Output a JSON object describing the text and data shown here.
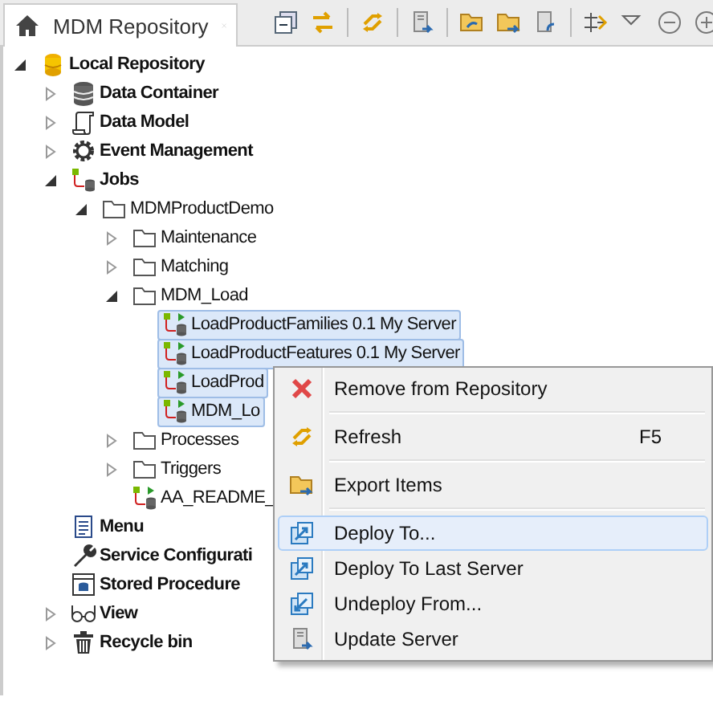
{
  "tab": {
    "title": "MDM Repository",
    "selected": true
  },
  "tree": [
    {
      "label": "Local Repository",
      "kind": "database",
      "expanded": true,
      "selected": false,
      "children": [
        {
          "label": "Data Container",
          "kind": "container",
          "expanded": false,
          "selected": false
        },
        {
          "label": "Data Model",
          "kind": "model",
          "expanded": false,
          "selected": false
        },
        {
          "label": "Event Management",
          "kind": "event",
          "expanded": false,
          "selected": false
        },
        {
          "label": "Jobs",
          "kind": "jobs",
          "expanded": true,
          "selected": false,
          "children": [
            {
              "label": "MDMProductDemo",
              "kind": "folder",
              "expanded": true,
              "selected": false,
              "children": [
                {
                  "label": "Maintenance",
                  "kind": "folder",
                  "expanded": false,
                  "selected": false
                },
                {
                  "label": "Matching",
                  "kind": "folder",
                  "expanded": false,
                  "selected": false
                },
                {
                  "label": "MDM_Load",
                  "kind": "folder",
                  "expanded": true,
                  "selected": false,
                  "children": [
                    {
                      "label": "LoadProductFamilies 0.1 My Server",
                      "kind": "job",
                      "selected": true
                    },
                    {
                      "label": "LoadProductFeatures 0.1 My Server",
                      "kind": "job",
                      "selected": true
                    },
                    {
                      "label": "LoadProd",
                      "kind": "job",
                      "selected": true
                    },
                    {
                      "label": "MDM_Lo",
                      "kind": "job",
                      "selected": true
                    }
                  ]
                },
                {
                  "label": "Processes",
                  "kind": "folder",
                  "expanded": false,
                  "selected": false
                },
                {
                  "label": "Triggers",
                  "kind": "folder",
                  "expanded": false,
                  "selected": false
                },
                {
                  "label": "AA_README_",
                  "kind": "job",
                  "selected": false
                }
              ]
            }
          ]
        },
        {
          "label": "Menu",
          "kind": "menu",
          "selected": false
        },
        {
          "label": "Service Configurati",
          "kind": "service",
          "selected": false
        },
        {
          "label": "Stored Procedure",
          "kind": "procedure",
          "selected": false
        },
        {
          "label": "View",
          "kind": "view",
          "expanded": false,
          "selected": false
        },
        {
          "label": "Recycle bin",
          "kind": "recycle",
          "expanded": false,
          "selected": false
        }
      ]
    }
  ],
  "context_menu": [
    {
      "label": "Remove from Repository",
      "kind": "remove",
      "selected": false,
      "separator_after": true
    },
    {
      "label": "Refresh",
      "kind": "refresh",
      "shortcut": "F5",
      "selected": false,
      "separator_after": true
    },
    {
      "label": "Export Items",
      "kind": "export",
      "selected": false,
      "separator_after": true
    },
    {
      "label": "Deploy To...",
      "kind": "deploy",
      "selected": true,
      "separator_after": false
    },
    {
      "label": "Deploy To Last Server",
      "kind": "deploy",
      "selected": false,
      "separator_after": false
    },
    {
      "label": "Undeploy From...",
      "kind": "undeploy",
      "selected": false,
      "separator_after": false
    },
    {
      "label": "Update Server",
      "kind": "server",
      "selected": false,
      "separator_after": false
    }
  ]
}
